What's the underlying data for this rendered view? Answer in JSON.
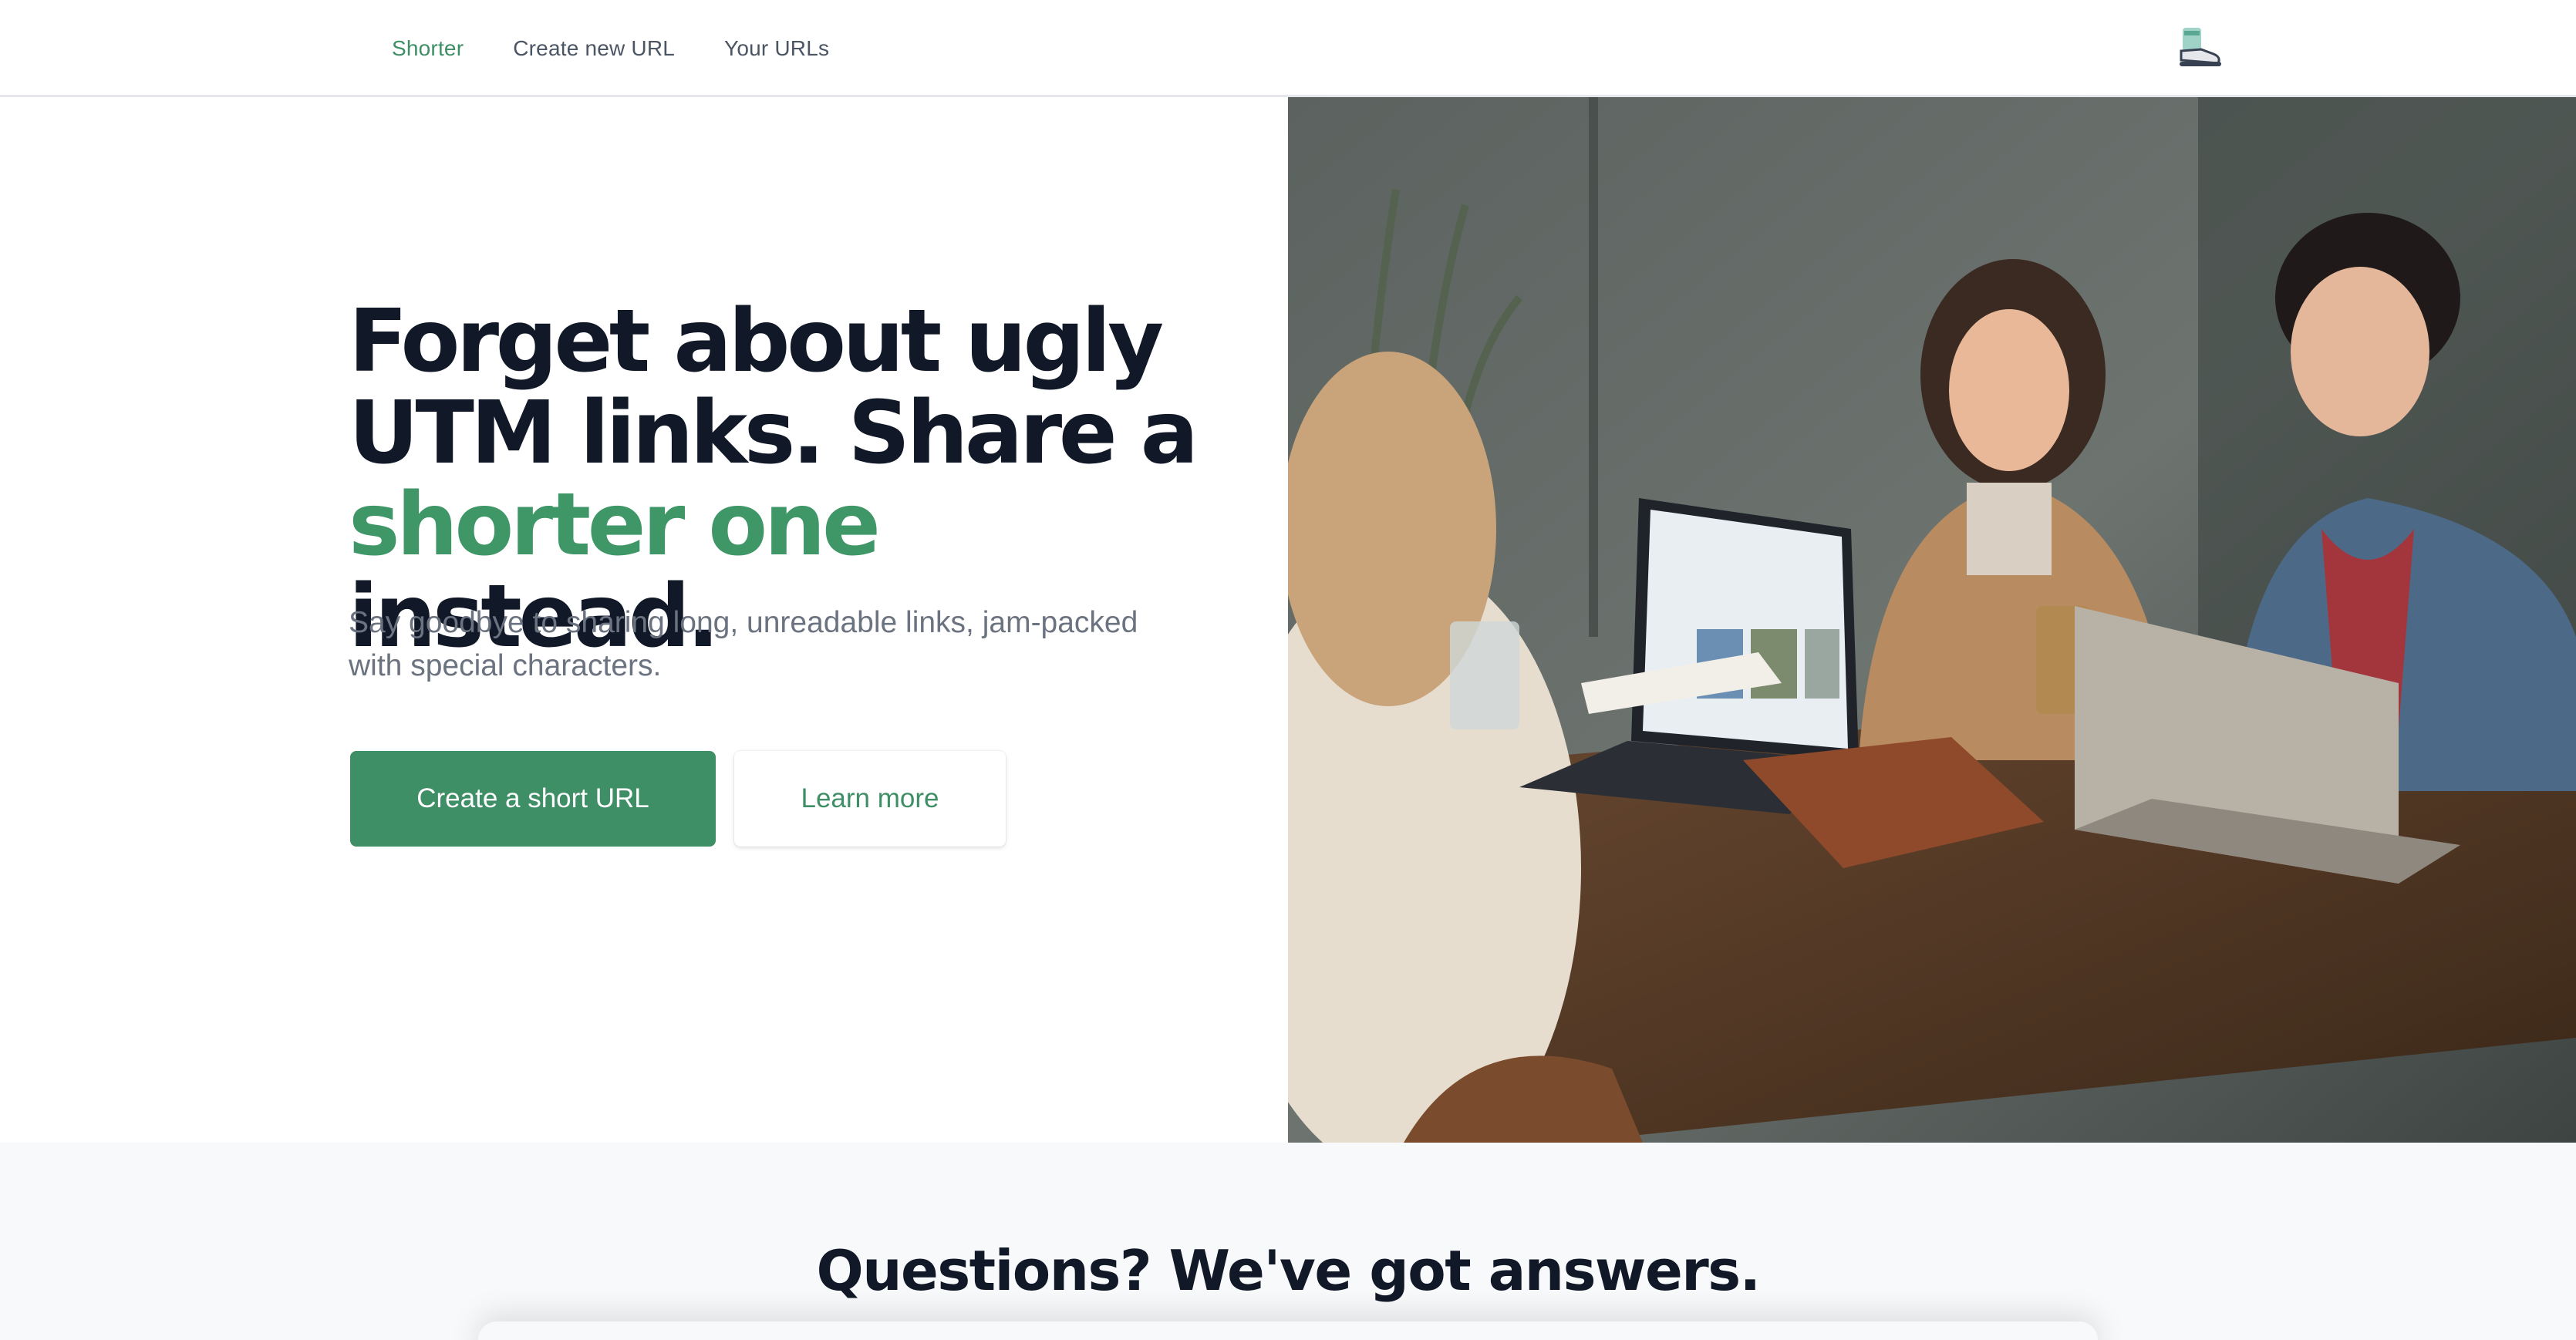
{
  "nav": {
    "links": [
      {
        "label": "Shorter",
        "active": true
      },
      {
        "label": "Create new URL",
        "active": false
      },
      {
        "label": "Your URLs",
        "active": false
      }
    ],
    "avatar_icon": "sneaker-avatar-icon"
  },
  "hero": {
    "headline_part1": "Forget about ugly UTM links. Share a ",
    "headline_accent": "shorter one",
    "headline_part2": " instead.",
    "subtitle": "Say goodbye to sharing long, unreadable links, jam-packed with special characters.",
    "primary_button": "Create a short URL",
    "secondary_button": "Learn more",
    "photo_description_icon": "people-with-laptops-photo"
  },
  "faq": {
    "title": "Questions? We've got answers."
  },
  "colors": {
    "brand_green": "#3f8f66",
    "headline_dark": "#111827",
    "muted_text": "#6b7280"
  }
}
